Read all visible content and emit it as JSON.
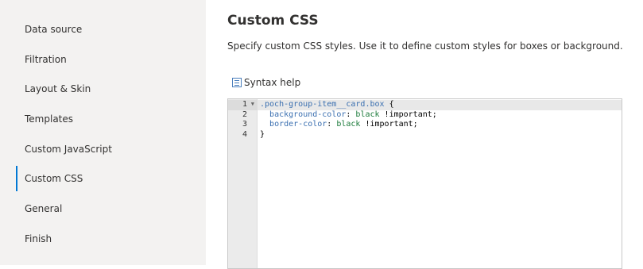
{
  "sidebar": {
    "items": [
      {
        "label": "Data source"
      },
      {
        "label": "Filtration"
      },
      {
        "label": "Layout & Skin"
      },
      {
        "label": "Templates"
      },
      {
        "label": "Custom JavaScript"
      },
      {
        "label": "Custom CSS",
        "active": true
      },
      {
        "label": "General"
      },
      {
        "label": "Finish"
      }
    ]
  },
  "main": {
    "title": "Custom CSS",
    "description": "Specify custom CSS styles. Use it to define custom styles for boxes or background.",
    "syntax_help": {
      "label": "Syntax help",
      "icon": "syntax-help-icon"
    }
  },
  "editor": {
    "line_numbers": [
      "1",
      "2",
      "3",
      "4"
    ],
    "lines": [
      {
        "selector": ".poch-group-item__card.box",
        "brace": " {"
      },
      {
        "indent": "  ",
        "prop": "background-color",
        "colon": ": ",
        "value": "black",
        "imp": " !important;"
      },
      {
        "indent": "  ",
        "prop": "border-color",
        "colon": ": ",
        "value": "black",
        "imp": " !important;"
      },
      {
        "brace": "}"
      }
    ]
  },
  "colors": {
    "accent": "#0078d4",
    "sidebar_bg": "#f3f2f1",
    "css_property": "#3a6fb0",
    "css_value": "#1b7a3a"
  }
}
